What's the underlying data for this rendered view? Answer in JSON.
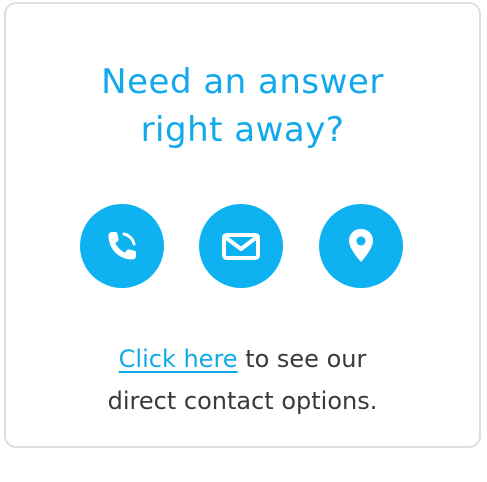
{
  "card": {
    "headline_line1": "Need an answer",
    "headline_line2": "right away?",
    "icons": [
      {
        "name": "phone-icon",
        "color": "#0fb2f0"
      },
      {
        "name": "envelope-icon",
        "color": "#0fb2f0"
      },
      {
        "name": "map-pin-icon",
        "color": "#0fb2f0"
      }
    ],
    "link_text": "Click here",
    "body_rest_line1": " to see our",
    "body_line2": "direct contact options."
  },
  "colors": {
    "accent": "#11a9ea",
    "icon_bg": "#0fb2f0",
    "text": "#3a3a3a",
    "border": "#dedede"
  }
}
